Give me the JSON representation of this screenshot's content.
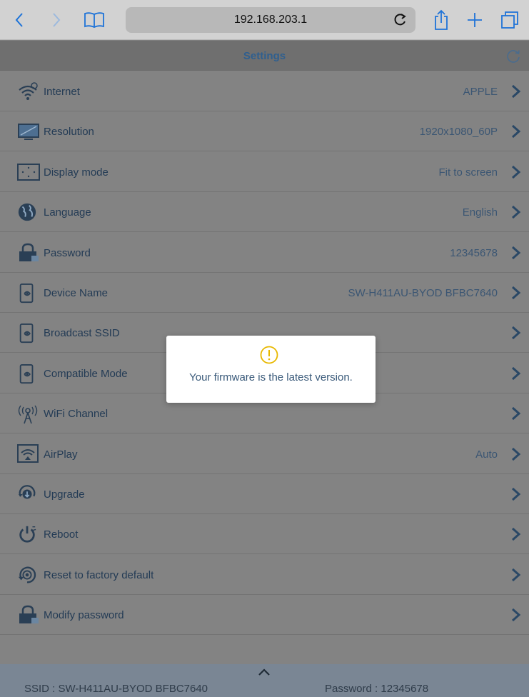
{
  "browser": {
    "url": "192.168.203.1"
  },
  "header": {
    "title": "Settings"
  },
  "rows": [
    {
      "label": "Internet",
      "value": "APPLE",
      "icon": "wifi-icon"
    },
    {
      "label": "Resolution",
      "value": "1920x1080_60P",
      "icon": "monitor-icon"
    },
    {
      "label": "Display mode",
      "value": "Fit to screen",
      "icon": "display-mode-icon"
    },
    {
      "label": "Language",
      "value": "English",
      "icon": "globe-icon"
    },
    {
      "label": "Password",
      "value": "12345678",
      "icon": "lock-icon"
    },
    {
      "label": "Device Name",
      "value": "SW-H411AU-BYOD BFBC7640",
      "icon": "device-icon"
    },
    {
      "label": "Broadcast SSID",
      "value": "",
      "icon": "device-icon"
    },
    {
      "label": "Compatible Mode",
      "value": "",
      "icon": "device-icon"
    },
    {
      "label": "WiFi Channel",
      "value": "",
      "icon": "antenna-icon"
    },
    {
      "label": "AirPlay",
      "value": "Auto",
      "icon": "airplay-icon"
    },
    {
      "label": "Upgrade",
      "value": "",
      "icon": "upgrade-icon"
    },
    {
      "label": "Reboot",
      "value": "",
      "icon": "power-icon"
    },
    {
      "label": "Reset to factory default",
      "value": "",
      "icon": "reset-icon"
    },
    {
      "label": "Modify password",
      "value": "",
      "icon": "lock-icon"
    }
  ],
  "footer": {
    "ssid": "SSID : SW-H411AU-BYOD BFBC7640",
    "password": "Password : 12345678"
  },
  "dialog": {
    "message": "Your firmware is the latest version."
  }
}
